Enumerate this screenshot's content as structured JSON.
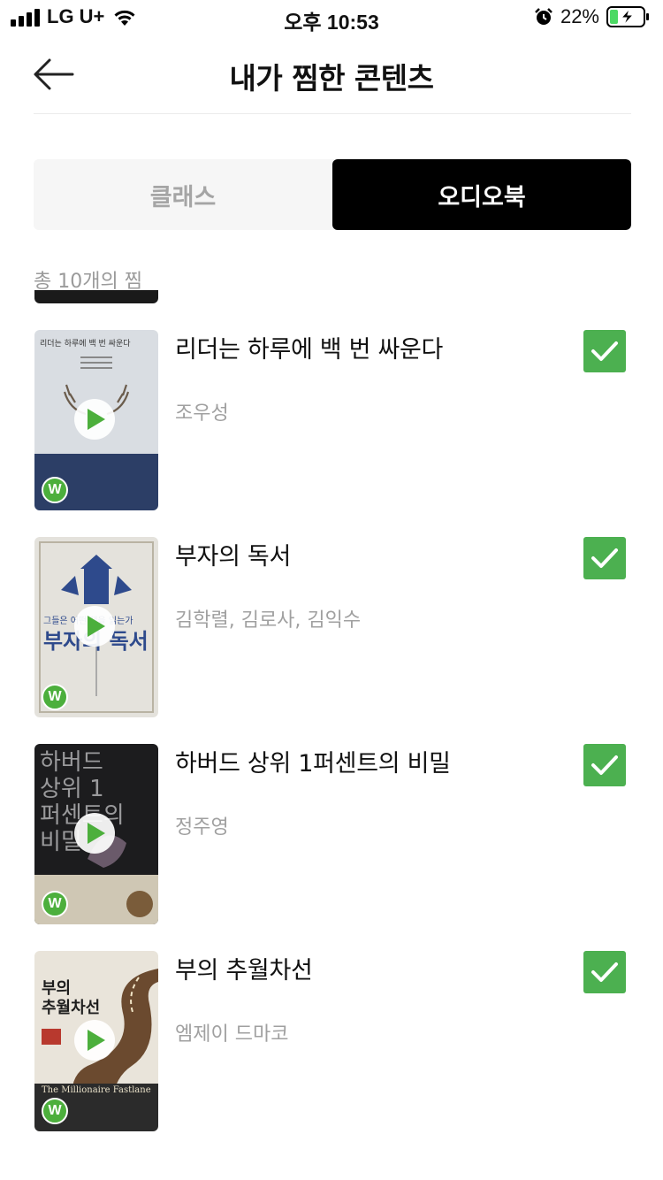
{
  "status_bar": {
    "carrier": "LG U+",
    "time": "오후 10:53",
    "battery_percent": "22%",
    "battery_level": 0.22
  },
  "header": {
    "title": "내가 찜한 콘텐츠",
    "back_icon": "arrow-left-icon"
  },
  "tabs": [
    {
      "label": "클래스",
      "active": false
    },
    {
      "label": "오디오북",
      "active": true
    }
  ],
  "count_label": "총 10개의 찜",
  "books": [
    {
      "title": "리더는 하루에 백 번 싸운다",
      "author": "조우성",
      "checked": true
    },
    {
      "title": "부자의 독서",
      "author": "김학렬, 김로사, 김익수",
      "checked": true
    },
    {
      "title": "하버드 상위 1퍼센트의 비밀",
      "author": "정주영",
      "checked": true
    },
    {
      "title": "부의 추월차선",
      "author": "엠제이 드마코",
      "checked": true
    }
  ],
  "covers": [
    {
      "top_text": "리더는 하루에 백 번 싸운다"
    },
    {
      "top_text": "그들은 어떤 책을 읽는가",
      "main_text": "부자의 독서"
    },
    {
      "top_text": "하버드 상위 1퍼센트의 비밀"
    },
    {
      "top_text": "부의 추월차선",
      "sub_text": "The Millionaire Fastlane"
    }
  ],
  "badge_letter": "W",
  "colors": {
    "check_green": "#4cb050",
    "play_green": "#4caf3c",
    "active_tab": "#000000",
    "inactive_tab_bg": "#f6f6f6"
  }
}
